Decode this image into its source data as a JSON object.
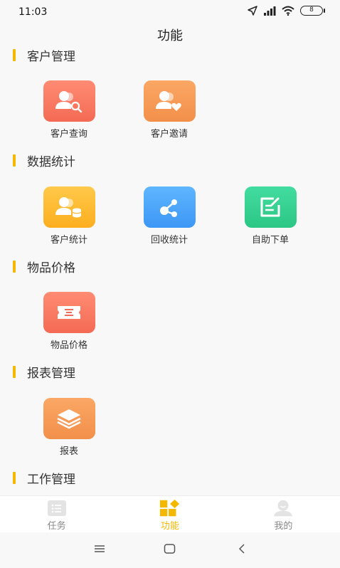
{
  "status": {
    "time": "11:03",
    "battery": "8"
  },
  "page": {
    "title": "功能"
  },
  "sections": [
    {
      "title": "客户管理",
      "items": [
        {
          "label": "客户查询",
          "icon": "user-search-icon"
        },
        {
          "label": "客户邀请",
          "icon": "user-heart-icon"
        }
      ]
    },
    {
      "title": "数据统计",
      "items": [
        {
          "label": "客户统计",
          "icon": "user-coins-icon"
        },
        {
          "label": "回收统计",
          "icon": "share-nodes-icon"
        },
        {
          "label": "自助下单",
          "icon": "edit-form-icon"
        }
      ]
    },
    {
      "title": "物品价格",
      "items": [
        {
          "label": "物品价格",
          "icon": "ticket-icon"
        }
      ]
    },
    {
      "title": "报表管理",
      "items": [
        {
          "label": "报表",
          "icon": "layers-icon"
        }
      ]
    },
    {
      "title": "工作管理",
      "items": []
    }
  ],
  "tabs": [
    {
      "label": "任务",
      "icon": "task-list-icon"
    },
    {
      "label": "功能",
      "icon": "function-grid-icon",
      "active": true
    },
    {
      "label": "我的",
      "icon": "profile-icon"
    }
  ],
  "colors": {
    "accent": "#f5b800"
  }
}
